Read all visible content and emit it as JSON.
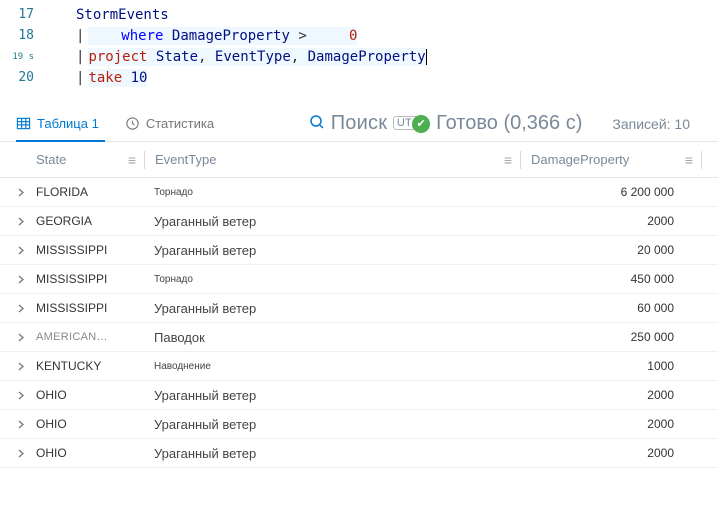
{
  "editor": {
    "lines": [
      {
        "num": "17",
        "tokens": [
          {
            "t": "StormEvents",
            "c": "tok-ident"
          }
        ]
      },
      {
        "num": "18",
        "pipe": true,
        "indent": true,
        "tokens": [
          {
            "t": "where",
            "c": "tok-keyword"
          },
          {
            "t": " DamageProperty",
            "c": "tok-col"
          },
          {
            "t": " > ",
            "c": "tok-op"
          },
          {
            "t": "   0",
            "c": "tok-num"
          }
        ]
      },
      {
        "num": "19 s",
        "small": true,
        "pipe": true,
        "tokens": [
          {
            "t": "project ",
            "c": "tok-keyword red"
          },
          {
            "t": "State",
            "c": "tok-col"
          },
          {
            "t": ", "
          },
          {
            "t": "EventType",
            "c": "tok-col"
          },
          {
            "t": ", "
          },
          {
            "t": "DamageProperty",
            "c": "tok-col"
          }
        ],
        "cursor": true
      },
      {
        "num": "20",
        "pipe": true,
        "tokens": [
          {
            "t": "take ",
            "c": "tok-keyword red"
          },
          {
            "t": "10",
            "c": "tok-num"
          }
        ]
      }
    ]
  },
  "tabs": {
    "table_label": "Таблица 1",
    "stats_label": "Статистика"
  },
  "search": {
    "placeholder": "Поиск",
    "utc": "UTC"
  },
  "status": {
    "ready": "Готово",
    "time": "(0,366 с)"
  },
  "records": {
    "label": "Записей:",
    "count": "10"
  },
  "columns": {
    "state": "State",
    "event": "EventType",
    "dmg": "DamageProperty"
  },
  "rows": [
    {
      "state": "FLORIDA",
      "event": "Торнадо",
      "event_small": true,
      "dmg": "6 200 000"
    },
    {
      "state": "GEORGIA",
      "event": "Ураганный ветер",
      "dmg": "2000"
    },
    {
      "state": "MISSISSIPPI",
      "event": "Ураганный ветер",
      "dmg": "20 000"
    },
    {
      "state": "MISSISSIPPI",
      "event": "Торнадо",
      "event_small": true,
      "dmg": "450 000"
    },
    {
      "state": "MISSISSIPPI",
      "event": "Ураганный ветер",
      "dmg": "60 000"
    },
    {
      "state": "AMERICAN…",
      "trunc": true,
      "event": "Паводок",
      "dmg": "250 000"
    },
    {
      "state": "KENTUCKY",
      "event": "Наводнение",
      "event_small": true,
      "dmg": "1000"
    },
    {
      "state": "OHIO",
      "event": "Ураганный ветер",
      "dmg": "2000"
    },
    {
      "state": "OHIO",
      "event": "Ураганный ветер",
      "dmg": "2000"
    },
    {
      "state": "OHIO",
      "event": "Ураганный ветер",
      "dmg": "2000"
    }
  ]
}
